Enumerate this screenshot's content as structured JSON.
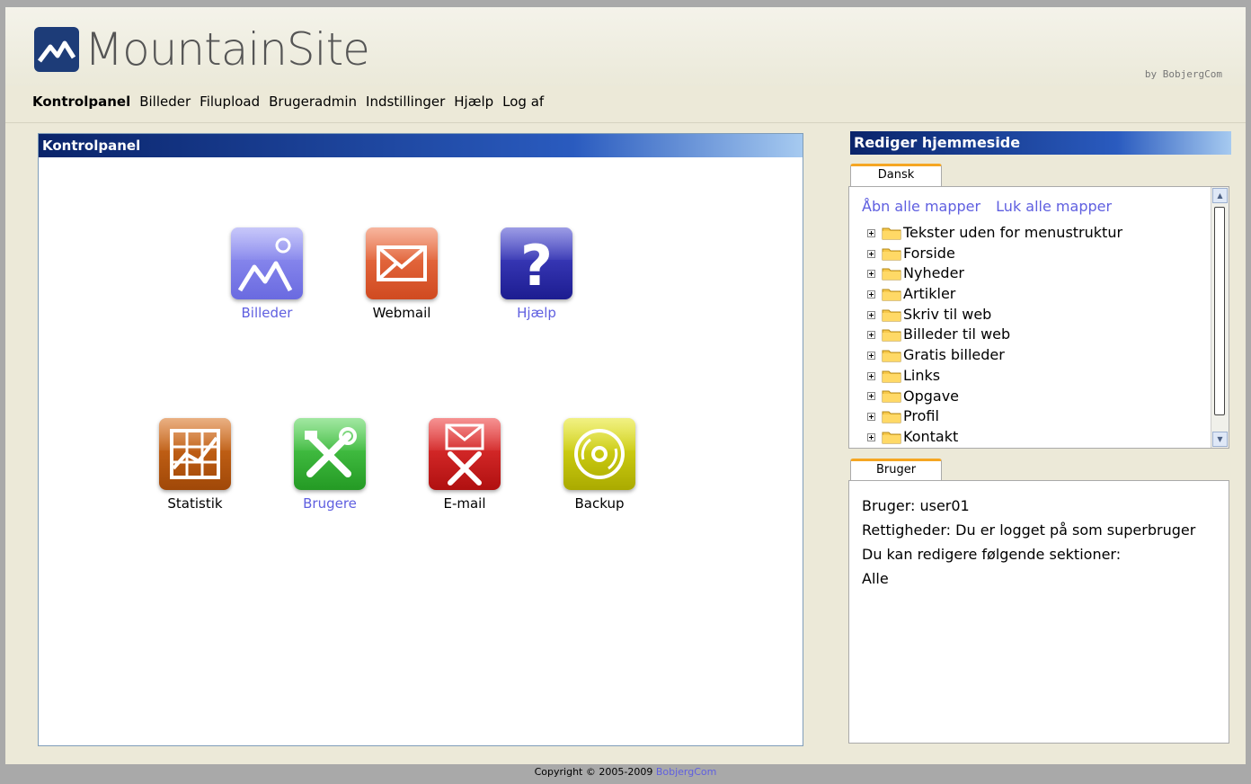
{
  "header": {
    "app_title": "MountainSite",
    "by_text": "by BobjergCom"
  },
  "nav": [
    {
      "label": "Kontrolpanel",
      "active": true
    },
    {
      "label": "Billeder"
    },
    {
      "label": "Filupload"
    },
    {
      "label": "Brugeradmin"
    },
    {
      "label": "Indstillinger"
    },
    {
      "label": "Hjælp"
    },
    {
      "label": "Log af"
    }
  ],
  "left_panel": {
    "title": "Kontrolpanel",
    "tiles": [
      {
        "label": "Billeder",
        "icon": "images-icon",
        "color": "#7b7bea",
        "link": true
      },
      {
        "label": "Webmail",
        "icon": "envelope-icon",
        "color": "#e8643c",
        "link": false
      },
      {
        "label": "Hjælp",
        "icon": "help-icon",
        "color": "#2c2cb0",
        "link": true
      },
      {
        "label": "Statistik",
        "icon": "statistics-icon",
        "color": "#c05a10",
        "link": false
      },
      {
        "label": "Brugere",
        "icon": "tools-icon",
        "color": "#3cba3c",
        "link": true
      },
      {
        "label": "E-mail",
        "icon": "email-tools-icon",
        "color": "#d42020",
        "link": false
      },
      {
        "label": "Backup",
        "icon": "disc-icon",
        "color": "#c8c80a",
        "link": false
      }
    ]
  },
  "right_panel": {
    "title": "Rediger hjemmeside",
    "tab_language": "Dansk",
    "open_all": "Åbn alle mapper",
    "close_all": "Luk alle mapper",
    "tree": [
      "Tekster uden for menustruktur",
      "Forside",
      "Nyheder",
      "Artikler",
      "Skriv til web",
      "Billeder til web",
      "Gratis billeder",
      "Links",
      "Opgave",
      "Profil",
      "Kontakt"
    ],
    "tab_user": "Bruger",
    "user_lines": [
      "Bruger: user01",
      "Rettigheder: Du er logget på som superbruger",
      "Du kan redigere følgende sektioner:",
      "Alle"
    ]
  },
  "footer": {
    "copyright": "Copyright © 2005-2009",
    "company": "BobjergCom"
  },
  "colors": {
    "title_bar_start": "#0a246a",
    "link": "#5f5fe0",
    "tab_accent": "#f5a623"
  }
}
